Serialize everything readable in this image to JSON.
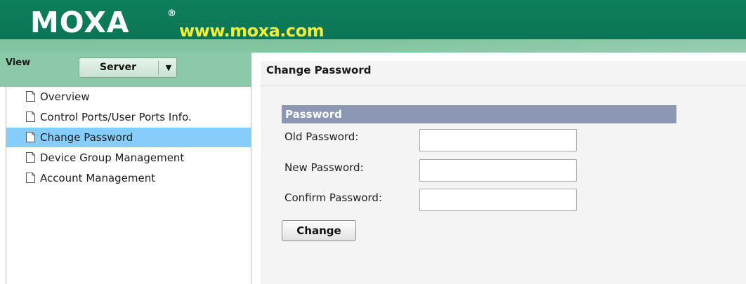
{
  "header": {
    "brand": "MOXA",
    "registered_mark": "®",
    "website": "www.moxa.com",
    "colors": {
      "banner": "#0a7555",
      "band": "#86c6a3",
      "website_text": "#f2ee35"
    }
  },
  "sidebar": {
    "view_label": "View",
    "view_select": {
      "value": "Server",
      "arrow_icon": "triangle-down-icon"
    },
    "items": [
      {
        "label": "Overview",
        "icon": "document-icon",
        "active": false
      },
      {
        "label": "Control Ports/User Ports Info.",
        "icon": "document-icon",
        "active": false
      },
      {
        "label": "Change Password",
        "icon": "document-icon",
        "active": true
      },
      {
        "label": "Device Group Management",
        "icon": "document-icon",
        "active": false
      },
      {
        "label": "Account Management",
        "icon": "document-icon",
        "active": false
      }
    ],
    "colors": {
      "active_item": "#86cdfb",
      "view_bar": "#8cc9a8"
    }
  },
  "main": {
    "page_title": "Change Password",
    "section": {
      "title": "Password",
      "color": "#8c97b4",
      "fields": [
        {
          "label": "Old Password:",
          "value": ""
        },
        {
          "label": "New Password:",
          "value": ""
        },
        {
          "label": "Confirm Password:",
          "value": ""
        }
      ]
    },
    "submit_label": "Change"
  }
}
